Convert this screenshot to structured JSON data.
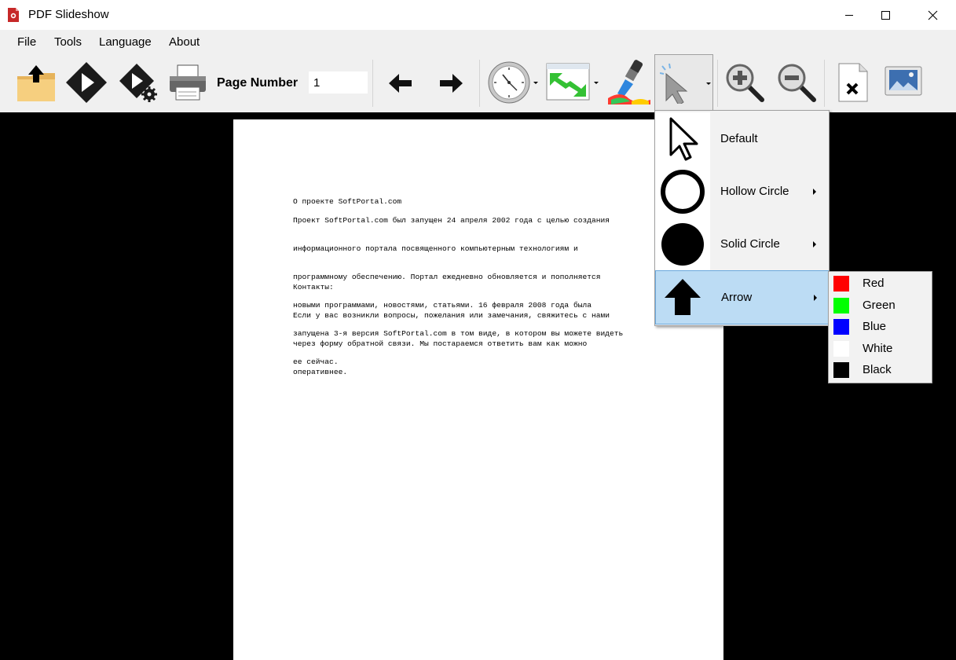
{
  "window": {
    "title": "PDF Slideshow"
  },
  "menubar": {
    "items": [
      "File",
      "Tools",
      "Language",
      "About"
    ]
  },
  "toolbar": {
    "page_number_label": "Page Number",
    "page_number_value": "1",
    "buttons": [
      "open-folder-icon",
      "play-icon",
      "play-settings-icon",
      "print-icon",
      "arrow-left-icon",
      "arrow-right-icon",
      "clock-icon",
      "transition-icon",
      "brush-icon",
      "pointer-icon",
      "zoom-in-icon",
      "zoom-out-icon",
      "close-document-icon",
      "image-icon"
    ]
  },
  "document": {
    "lines_block1": [
      "О проекте SoftPortal.com"
    ],
    "lines_block2": [
      "Проект SoftPortal.com был запущен 24 апреля 2002 года с целью создания",
      "информационного портала посвященного компьютерным технологиям и",
      "программному обеспечению. Портал ежедневно обновляется и пополняется",
      "новыми программами, новостями, статьями. 16 февраля 2008 года была",
      "запущена 3-я версия SoftPortal.com в том виде, в котором вы можете видеть",
      "ее сейчас."
    ],
    "lines_block3": [
      "Контакты:",
      "Если у вас возникли вопросы, пожелания или замечания, свяжитесь с нами",
      "через форму обратной связи. Мы постараемся ответить вам как можно",
      "оперативнее."
    ]
  },
  "pointer_menu": {
    "items": [
      {
        "label": "Default",
        "icon": "cursor-arrow-icon",
        "submenu": false
      },
      {
        "label": "Hollow Circle",
        "icon": "hollow-circle-icon",
        "submenu": true
      },
      {
        "label": "Solid Circle",
        "icon": "solid-circle-icon",
        "submenu": true
      },
      {
        "label": "Arrow",
        "icon": "arrow-up-icon",
        "submenu": true,
        "selected": true
      }
    ]
  },
  "color_menu": {
    "items": [
      {
        "label": "Red",
        "color": "#ff0000"
      },
      {
        "label": "Green",
        "color": "#00ff00"
      },
      {
        "label": "Blue",
        "color": "#0000ff"
      },
      {
        "label": "White",
        "color": "#ffffff"
      },
      {
        "label": "Black",
        "color": "#000000"
      }
    ]
  }
}
